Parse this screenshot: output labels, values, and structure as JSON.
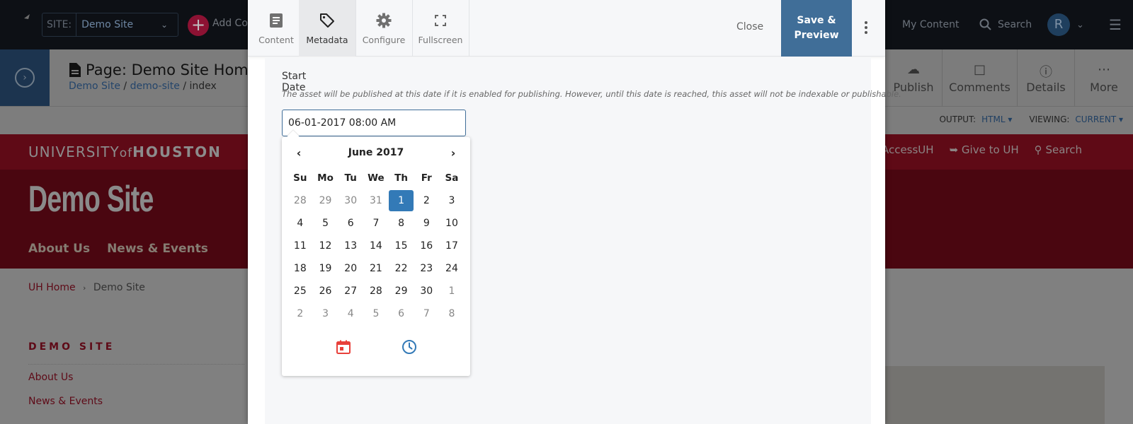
{
  "topbar": {
    "site_label": "SITE:",
    "site_value": "Demo Site",
    "add_content_label": "Add Co",
    "my_content": "My Content",
    "search": "Search",
    "avatar_initial": "R"
  },
  "page": {
    "title": "Page: Demo Site Home",
    "breadcrumb": [
      "Demo Site",
      "demo-site",
      "index"
    ],
    "actions": [
      {
        "label": "Publish",
        "icon": "cloud-check-icon"
      },
      {
        "label": "Comments",
        "icon": "comment-icon"
      },
      {
        "label": "Details",
        "icon": "info-icon"
      },
      {
        "label": "More",
        "icon": "more-dots-icon"
      }
    ],
    "output_label": "OUTPUT:",
    "output_value": "HTML",
    "viewing_label": "VIEWING:",
    "viewing_value": "CURRENT"
  },
  "preview": {
    "university_text_light": "UNIVERSITY",
    "university_of": "of",
    "university_text_bold": "HOUSTON",
    "top_links": [
      "to AccessUH",
      "Give to UH",
      "Search"
    ],
    "site_title": "Demo Site",
    "nav": [
      "About Us",
      "News & Events"
    ],
    "breadcrumb": [
      "UH Home",
      "Demo Site"
    ],
    "side_title": "DEMO SITE",
    "side_links": [
      "About Us",
      "News & Events"
    ]
  },
  "modal": {
    "tabs": [
      {
        "label": "Content",
        "icon": "document-icon",
        "active": false
      },
      {
        "label": "Metadata",
        "icon": "tag-icon",
        "active": true
      },
      {
        "label": "Configure",
        "icon": "gear-icon",
        "active": false
      },
      {
        "label": "Fullscreen",
        "icon": "fullscreen-icon",
        "active": false
      }
    ],
    "close_label": "Close",
    "save_label_line1": "Save &",
    "save_label_line2": "Preview",
    "field": {
      "label": "Start Date",
      "help": "The asset will be published at this date if it is enabled for publishing. However, until this date is reached, this asset will not be indexable or publishable.",
      "value": "06-01-2017 08:00 AM"
    },
    "datepicker": {
      "title": "June 2017",
      "weekdays": [
        "Su",
        "Mo",
        "Tu",
        "We",
        "Th",
        "Fr",
        "Sa"
      ],
      "weeks": [
        [
          {
            "d": "28",
            "m": true
          },
          {
            "d": "29",
            "m": true
          },
          {
            "d": "30",
            "m": true
          },
          {
            "d": "31",
            "m": true
          },
          {
            "d": "1",
            "s": true
          },
          {
            "d": "2"
          },
          {
            "d": "3"
          }
        ],
        [
          {
            "d": "4"
          },
          {
            "d": "5"
          },
          {
            "d": "6"
          },
          {
            "d": "7"
          },
          {
            "d": "8"
          },
          {
            "d": "9"
          },
          {
            "d": "10"
          }
        ],
        [
          {
            "d": "11"
          },
          {
            "d": "12"
          },
          {
            "d": "13"
          },
          {
            "d": "14"
          },
          {
            "d": "15"
          },
          {
            "d": "16"
          },
          {
            "d": "17"
          }
        ],
        [
          {
            "d": "18"
          },
          {
            "d": "19"
          },
          {
            "d": "20"
          },
          {
            "d": "21"
          },
          {
            "d": "22"
          },
          {
            "d": "23"
          },
          {
            "d": "24"
          }
        ],
        [
          {
            "d": "25"
          },
          {
            "d": "26"
          },
          {
            "d": "27"
          },
          {
            "d": "28"
          },
          {
            "d": "29"
          },
          {
            "d": "30"
          },
          {
            "d": "1",
            "m": true
          }
        ],
        [
          {
            "d": "2",
            "m": true
          },
          {
            "d": "3",
            "m": true
          },
          {
            "d": "4",
            "m": true
          },
          {
            "d": "5",
            "m": true
          },
          {
            "d": "6",
            "m": true
          },
          {
            "d": "7",
            "m": true
          },
          {
            "d": "8",
            "m": true
          }
        ]
      ],
      "selected": "1",
      "calendar_icon_color": "#e8403a",
      "clock_icon_color": "#337ab7"
    }
  },
  "colors": {
    "accent": "#406e98",
    "selected_day": "#337ab7",
    "uh_red": "#c8102e"
  }
}
